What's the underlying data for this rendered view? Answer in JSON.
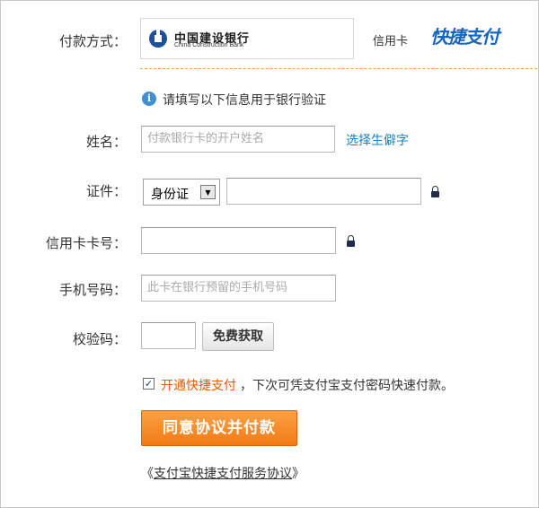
{
  "payment_method": {
    "label": "付款方式：",
    "bank_cn": "中国建设银行",
    "bank_en": "China Construction Bank",
    "card_type": "信用卡",
    "quickpay_logo": "快捷支付"
  },
  "info": {
    "icon": "info-icon",
    "text": "请填写以下信息用于银行验证"
  },
  "name": {
    "label": "姓名：",
    "placeholder": "付款银行卡的开户姓名",
    "rare_char_link": "选择生僻字"
  },
  "id": {
    "label": "证件：",
    "type_selected": "身份证",
    "value": ""
  },
  "card_number": {
    "label": "信用卡卡号：",
    "value": ""
  },
  "phone": {
    "label": "手机号码：",
    "placeholder": "此卡在银行预留的手机号码"
  },
  "verify_code": {
    "label": "校验码：",
    "value": "",
    "get_button": "免费获取"
  },
  "agree": {
    "checked": true,
    "link": "开通快捷支付",
    "rest": "，下次可凭支付宝支付密码快速付款。"
  },
  "submit": {
    "label": "同意协议并付款"
  },
  "agreement": {
    "prefix": "《",
    "link": "支付宝快捷支付服务协议",
    "suffix": "》"
  },
  "colors": {
    "accent_orange": "#f27a14",
    "link_blue": "#1a80c4",
    "bank_blue": "#1c4f9c"
  }
}
